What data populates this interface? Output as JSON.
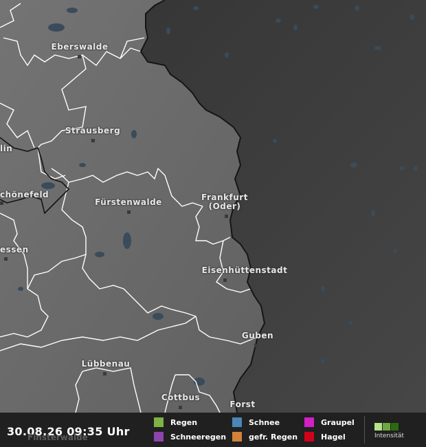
{
  "map": {
    "cities": [
      {
        "name": "Eberswalde"
      },
      {
        "name": "Strausberg"
      },
      {
        "name": "lin"
      },
      {
        "name": "chönefeld"
      },
      {
        "name": "Fürstenwalde"
      },
      {
        "name": "Frankfurt\n(Oder)"
      },
      {
        "name": "essen"
      },
      {
        "name": "Eisenhüttenstadt"
      },
      {
        "name": "Guben"
      },
      {
        "name": "Lübbenau"
      },
      {
        "name": "Cottbus"
      },
      {
        "name": "Forst"
      },
      {
        "name": "Finsterwalde"
      }
    ]
  },
  "footer": {
    "timestamp": "30.08.26 09:35 Uhr",
    "legend": [
      {
        "label": "Regen",
        "color": "#7cb342"
      },
      {
        "label": "Schneeregen",
        "color": "#8e44ad"
      },
      {
        "label": "Schnee",
        "color": "#4a86b8"
      },
      {
        "label": "gefr. Regen",
        "color": "#d2823a"
      },
      {
        "label": "Graupel",
        "color": "#d21fc8"
      },
      {
        "label": "Hagel",
        "color": "#d0021b"
      }
    ],
    "intensity_label": "Intensität",
    "intensity_colors": [
      "#b6e388",
      "#6ea742",
      "#2d6a0f"
    ]
  },
  "colors": {
    "germany_land": "#727272",
    "poland_land": "#3c3c3c",
    "water": "#3d4d5c",
    "border_national": "#111111",
    "border_districts": "#ffffff"
  }
}
